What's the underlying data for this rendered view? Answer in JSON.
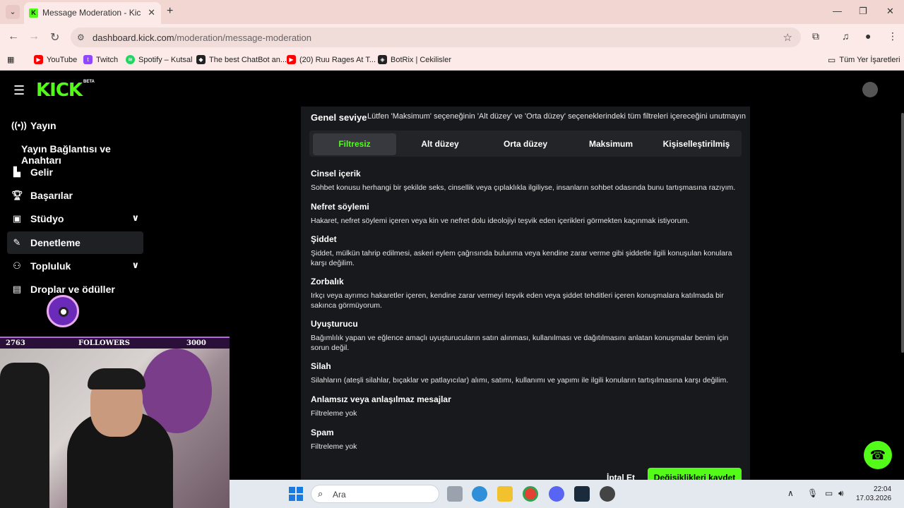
{
  "browser": {
    "tab_title": "Message Moderation - Kick Dashboard",
    "url_host": "dashboard.kick.com",
    "url_path": "/moderation/message-moderation",
    "bookmarks": [
      {
        "label": "YouTube",
        "color": "#ff0000"
      },
      {
        "label": "Twitch",
        "color": "#9146ff"
      },
      {
        "label": "Spotify – Kutsal",
        "color": "#1ed760"
      },
      {
        "label": "The best ChatBot an...",
        "color": "#222222"
      },
      {
        "label": "(20) Ruu Rages At T...",
        "color": "#ff0000"
      },
      {
        "label": "BotRix | Cekilisler",
        "color": "#222222"
      }
    ],
    "all_bookmarks_label": "Tüm Yer İşaretleri"
  },
  "sidebar": {
    "items": [
      {
        "label": "Yayın",
        "icon": "broadcast-icon"
      },
      {
        "label": "Yayın Bağlantısı ve Anahtarı",
        "icon": ""
      },
      {
        "label": "Gelir",
        "icon": "chart-icon"
      },
      {
        "label": "Başarılar",
        "icon": "trophy-icon"
      },
      {
        "label": "Stüdyo",
        "icon": "studio-icon"
      },
      {
        "label": "Denetleme",
        "icon": "wrench-icon"
      },
      {
        "label": "Topluluk",
        "icon": "community-icon"
      },
      {
        "label": "Droplar ve ödüller",
        "icon": "gift-icon"
      }
    ]
  },
  "moderation": {
    "level_title": "Genel seviye",
    "level_note": "Lütfen 'Maksimum' seçeneğinin 'Alt düzey' ve 'Orta düzey' seçeneklerindeki tüm filtreleri içereceğini unutmayın",
    "levels": [
      "Filtresiz",
      "Alt düzey",
      "Orta düzey",
      "Maksimum",
      "Kişiselleştirilmiş"
    ],
    "selected_level": "Filtresiz",
    "categories": [
      {
        "title": "Cinsel içerik",
        "desc": "Sohbet konusu herhangi bir şekilde seks, cinsellik veya çıplaklıkla ilgiliyse, insanların sohbet odasında bunu tartışmasına razıyım."
      },
      {
        "title": "Nefret söylemi",
        "desc": "Hakaret, nefret söylemi içeren veya kin ve nefret dolu ideolojiyi teşvik eden içerikleri görmekten kaçınmak istiyorum."
      },
      {
        "title": "Şiddet",
        "desc": "Şiddet, mülkün tahrip edilmesi, askeri eylem çağrısında bulunma veya kendine zarar verme gibi şiddetle ilgili konuşulan konulara karşı değilim."
      },
      {
        "title": "Zorbalık",
        "desc": "Irkçı veya ayrımcı hakaretler içeren, kendine zarar vermeyi teşvik eden veya şiddet tehditleri içeren konuşmalara katılmada bir sakınca görmüyorum."
      },
      {
        "title": "Uyuşturucu",
        "desc": "Bağımlılık yapan ve eğlence amaçlı uyuşturucuların satın alınması, kullanılması ve dağıtılmasını anlatan konuşmalar benim için sorun değil."
      },
      {
        "title": "Silah",
        "desc": "Silahların (ateşli silahlar, bıçaklar ve patlayıcılar) alımı, satımı, kullanımı ve yapımı ile ilgili konuların tartışılmasına karşı değilim."
      },
      {
        "title": "Anlamsız veya anlaşılmaz mesajlar",
        "desc": "Filtreleme yok"
      },
      {
        "title": "Spam",
        "desc": "Filtreleme yok"
      }
    ],
    "cancel_label": "İptal Et",
    "save_label": "Değişiklikleri kaydet"
  },
  "overlay": {
    "followers_current": "2763",
    "followers_label": "FOLLOWERS",
    "followers_goal": "3000"
  },
  "taskbar": {
    "search_placeholder": "Ara",
    "time": "22:04",
    "date": "17.03.2026"
  },
  "colors": {
    "kick_green": "#53fc18",
    "panel_bg": "#18191c",
    "tab_bg": "#f1d6d2"
  }
}
